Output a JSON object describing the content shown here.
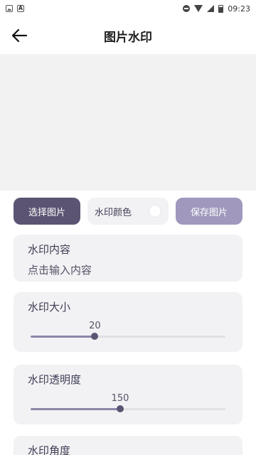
{
  "status_bar": {
    "time": "09:23"
  },
  "header": {
    "title": "图片水印"
  },
  "buttons": {
    "select_label": "选择图片",
    "color_label": "水印颜色",
    "save_label": "保存图片",
    "watermark_color": "#ffffff"
  },
  "content_card": {
    "label": "水印内容",
    "placeholder": "点击输入内容"
  },
  "size_card": {
    "label": "水印大小",
    "value": "20",
    "level_fraction": 0.33
  },
  "opacity_card": {
    "label": "水印透明度",
    "value": "150",
    "level_fraction": 0.46
  },
  "angle_card": {
    "label": "水印角度"
  },
  "colors": {
    "accent": "#5b5472",
    "save": "#a099bd",
    "card_bg": "#f2f2f4"
  }
}
